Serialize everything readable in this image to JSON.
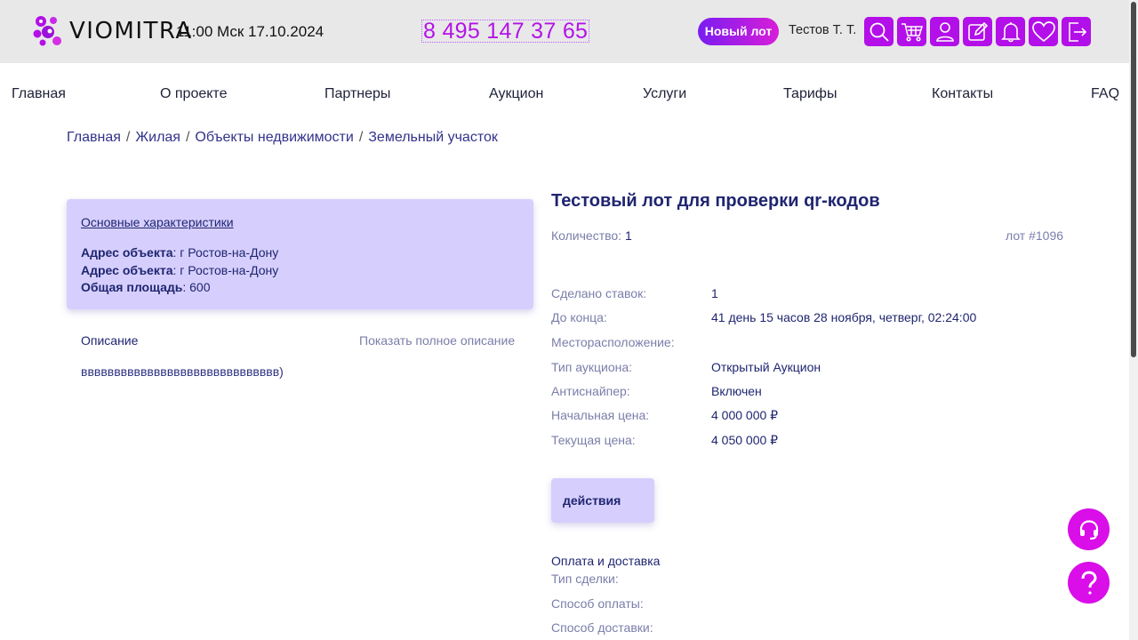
{
  "header": {
    "logo_text": "VIOMITRA",
    "datetime": "11:00 Мск 17.10.2024",
    "phone": "8 495 147 37 65",
    "new_lot_label": "Новый лот",
    "user_name": "Тестов Т. Т.",
    "icons": [
      "search-icon",
      "cart-icon",
      "user-icon",
      "edit-icon",
      "bell-icon",
      "heart-icon",
      "logout-icon"
    ]
  },
  "nav": {
    "items": [
      "Главная",
      "О проекте",
      "Партнеры",
      "Аукцион",
      "Услуги",
      "Тарифы",
      "Контакты",
      "FAQ"
    ]
  },
  "breadcrumb": [
    "Главная",
    "Жилая",
    "Объекты недвижимости",
    "Земельный участок"
  ],
  "characteristics": {
    "title": "Основные характеристики",
    "rows": [
      {
        "label": "Адрес объекта",
        "value": ": г Ростов-на-Дону"
      },
      {
        "label": "Адрес объекта",
        "value": ": г Ростов-на-Дону"
      },
      {
        "label": "Общая площадь",
        "value": ": 600"
      }
    ]
  },
  "description": {
    "title": "Описание",
    "show_more": "Показать полное описание",
    "text": "вввввввввввввввввввввввввввввв)"
  },
  "lot": {
    "title": "Тестовый лот для проверки qr-кодов",
    "qty_label": "Количество:",
    "qty_value": "1",
    "lot_number": "лот #1096",
    "info": [
      {
        "label": "Сделано ставок:",
        "value": "1"
      },
      {
        "label": "До конца:",
        "value": "41 день 15 часов 28 ноября, четверг, 02:24:00"
      },
      {
        "label": "Месторасположение:",
        "value": ""
      },
      {
        "label": "Тип аукциона:",
        "value": "Открытый Аукцион"
      },
      {
        "label": "Антиснайпер:",
        "value": "Включен"
      },
      {
        "label": "Начальная цена:",
        "value": "4 000 000 ₽"
      },
      {
        "label": "Текущая цена:",
        "value": "4 050 000 ₽"
      }
    ],
    "actions_label": "действия",
    "payment_title": "Оплата и доставка",
    "payment_rows": [
      "Тип сделки:",
      "Способ оплаты:",
      "Способ доставки:"
    ]
  },
  "colors": {
    "accent": "#b30fe8",
    "card_bg": "#d6cffd",
    "text_dark": "#1f2570",
    "text_muted": "#7a7ea9"
  },
  "floating": [
    "headset-icon",
    "question-icon"
  ]
}
